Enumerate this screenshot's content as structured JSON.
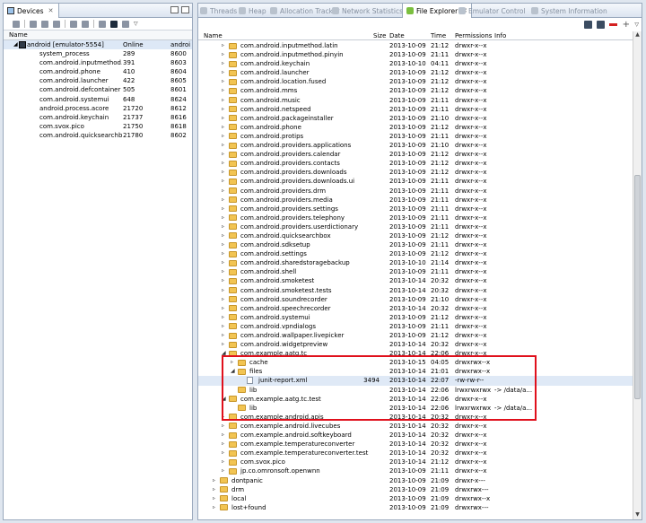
{
  "devices_view": {
    "tab_label": "Devices",
    "tab_close": "✕",
    "columns": {
      "name": "Name"
    },
    "device": {
      "name": "android [emulator-5554]",
      "status": "Online",
      "col3": "androi"
    },
    "processes": [
      {
        "name": "system_process",
        "pid": "289",
        "port": "8600"
      },
      {
        "name": "com.android.inputmethod.lati",
        "pid": "391",
        "port": "8603"
      },
      {
        "name": "com.android.phone",
        "pid": "410",
        "port": "8604"
      },
      {
        "name": "com.android.launcher",
        "pid": "422",
        "port": "8605"
      },
      {
        "name": "com.android.defcontainer",
        "pid": "505",
        "port": "8601"
      },
      {
        "name": "com.android.systemui",
        "pid": "648",
        "port": "8624"
      },
      {
        "name": "android.process.acore",
        "pid": "21720",
        "port": "8612"
      },
      {
        "name": "com.android.keychain",
        "pid": "21737",
        "port": "8616"
      },
      {
        "name": "com.svox.pico",
        "pid": "21750",
        "port": "8618"
      },
      {
        "name": "com.android.quicksearchbox",
        "pid": "21780",
        "port": "8602"
      }
    ]
  },
  "main_tabs": [
    {
      "label": "Threads",
      "icon": "threads-icon"
    },
    {
      "label": "Heap",
      "icon": "heap-icon"
    },
    {
      "label": "Allocation Tracker",
      "icon": "allocation-icon"
    },
    {
      "label": "Network Statistics",
      "icon": "network-icon"
    },
    {
      "label": "File Explorer",
      "icon": "file-explorer-icon",
      "active": true
    },
    {
      "label": "Emulator Control",
      "icon": "emulator-icon"
    },
    {
      "label": "System Information",
      "icon": "system-info-icon"
    }
  ],
  "file_explorer": {
    "columns": {
      "name": "Name",
      "size": "Size",
      "date": "Date",
      "time": "Time",
      "permissions": "Permissions",
      "info": "Info"
    },
    "rows": [
      {
        "indent": 2,
        "tw": "▹",
        "kind": "folder",
        "name": "com.android.inputmethod.latin",
        "date": "2013-10-09",
        "time": "21:12",
        "perm": "drwxr-x--x"
      },
      {
        "indent": 2,
        "tw": "▹",
        "kind": "folder",
        "name": "com.android.inputmethod.pinyin",
        "date": "2013-10-09",
        "time": "21:11",
        "perm": "drwxr-x--x"
      },
      {
        "indent": 2,
        "tw": "▹",
        "kind": "folder",
        "name": "com.android.keychain",
        "date": "2013-10-10",
        "time": "04:11",
        "perm": "drwxr-x--x"
      },
      {
        "indent": 2,
        "tw": "▹",
        "kind": "folder",
        "name": "com.android.launcher",
        "date": "2013-10-09",
        "time": "21:12",
        "perm": "drwxr-x--x"
      },
      {
        "indent": 2,
        "tw": "▹",
        "kind": "folder",
        "name": "com.android.location.fused",
        "date": "2013-10-09",
        "time": "21:12",
        "perm": "drwxr-x--x"
      },
      {
        "indent": 2,
        "tw": "▹",
        "kind": "folder",
        "name": "com.android.mms",
        "date": "2013-10-09",
        "time": "21:12",
        "perm": "drwxr-x--x"
      },
      {
        "indent": 2,
        "tw": "▹",
        "kind": "folder",
        "name": "com.android.music",
        "date": "2013-10-09",
        "time": "21:11",
        "perm": "drwxr-x--x"
      },
      {
        "indent": 2,
        "tw": "▹",
        "kind": "folder",
        "name": "com.android.netspeed",
        "date": "2013-10-09",
        "time": "21:11",
        "perm": "drwxr-x--x"
      },
      {
        "indent": 2,
        "tw": "▹",
        "kind": "folder",
        "name": "com.android.packageinstaller",
        "date": "2013-10-09",
        "time": "21:10",
        "perm": "drwxr-x--x"
      },
      {
        "indent": 2,
        "tw": "▹",
        "kind": "folder",
        "name": "com.android.phone",
        "date": "2013-10-09",
        "time": "21:12",
        "perm": "drwxr-x--x"
      },
      {
        "indent": 2,
        "tw": "▹",
        "kind": "folder",
        "name": "com.android.protips",
        "date": "2013-10-09",
        "time": "21:11",
        "perm": "drwxr-x--x"
      },
      {
        "indent": 2,
        "tw": "▹",
        "kind": "folder",
        "name": "com.android.providers.applications",
        "date": "2013-10-09",
        "time": "21:10",
        "perm": "drwxr-x--x"
      },
      {
        "indent": 2,
        "tw": "▹",
        "kind": "folder",
        "name": "com.android.providers.calendar",
        "date": "2013-10-09",
        "time": "21:12",
        "perm": "drwxr-x--x"
      },
      {
        "indent": 2,
        "tw": "▹",
        "kind": "folder",
        "name": "com.android.providers.contacts",
        "date": "2013-10-09",
        "time": "21:12",
        "perm": "drwxr-x--x"
      },
      {
        "indent": 2,
        "tw": "▹",
        "kind": "folder",
        "name": "com.android.providers.downloads",
        "date": "2013-10-09",
        "time": "21:12",
        "perm": "drwxr-x--x"
      },
      {
        "indent": 2,
        "tw": "▹",
        "kind": "folder",
        "name": "com.android.providers.downloads.ui",
        "date": "2013-10-09",
        "time": "21:11",
        "perm": "drwxr-x--x"
      },
      {
        "indent": 2,
        "tw": "▹",
        "kind": "folder",
        "name": "com.android.providers.drm",
        "date": "2013-10-09",
        "time": "21:11",
        "perm": "drwxr-x--x"
      },
      {
        "indent": 2,
        "tw": "▹",
        "kind": "folder",
        "name": "com.android.providers.media",
        "date": "2013-10-09",
        "time": "21:11",
        "perm": "drwxr-x--x"
      },
      {
        "indent": 2,
        "tw": "▹",
        "kind": "folder",
        "name": "com.android.providers.settings",
        "date": "2013-10-09",
        "time": "21:11",
        "perm": "drwxr-x--x"
      },
      {
        "indent": 2,
        "tw": "▹",
        "kind": "folder",
        "name": "com.android.providers.telephony",
        "date": "2013-10-09",
        "time": "21:11",
        "perm": "drwxr-x--x"
      },
      {
        "indent": 2,
        "tw": "▹",
        "kind": "folder",
        "name": "com.android.providers.userdictionary",
        "date": "2013-10-09",
        "time": "21:11",
        "perm": "drwxr-x--x"
      },
      {
        "indent": 2,
        "tw": "▹",
        "kind": "folder",
        "name": "com.android.quicksearchbox",
        "date": "2013-10-09",
        "time": "21:12",
        "perm": "drwxr-x--x"
      },
      {
        "indent": 2,
        "tw": "▹",
        "kind": "folder",
        "name": "com.android.sdksetup",
        "date": "2013-10-09",
        "time": "21:11",
        "perm": "drwxr-x--x"
      },
      {
        "indent": 2,
        "tw": "▹",
        "kind": "folder",
        "name": "com.android.settings",
        "date": "2013-10-09",
        "time": "21:12",
        "perm": "drwxr-x--x"
      },
      {
        "indent": 2,
        "tw": "▹",
        "kind": "folder",
        "name": "com.android.sharedstoragebackup",
        "date": "2013-10-10",
        "time": "21:14",
        "perm": "drwxr-x--x"
      },
      {
        "indent": 2,
        "tw": "▹",
        "kind": "folder",
        "name": "com.android.shell",
        "date": "2013-10-09",
        "time": "21:11",
        "perm": "drwxr-x--x"
      },
      {
        "indent": 2,
        "tw": "▹",
        "kind": "folder",
        "name": "com.android.smoketest",
        "date": "2013-10-14",
        "time": "20:32",
        "perm": "drwxr-x--x"
      },
      {
        "indent": 2,
        "tw": "▹",
        "kind": "folder",
        "name": "com.android.smoketest.tests",
        "date": "2013-10-14",
        "time": "20:32",
        "perm": "drwxr-x--x"
      },
      {
        "indent": 2,
        "tw": "▹",
        "kind": "folder",
        "name": "com.android.soundrecorder",
        "date": "2013-10-09",
        "time": "21:10",
        "perm": "drwxr-x--x"
      },
      {
        "indent": 2,
        "tw": "▹",
        "kind": "folder",
        "name": "com.android.speechrecorder",
        "date": "2013-10-14",
        "time": "20:32",
        "perm": "drwxr-x--x"
      },
      {
        "indent": 2,
        "tw": "▹",
        "kind": "folder",
        "name": "com.android.systemui",
        "date": "2013-10-09",
        "time": "21:12",
        "perm": "drwxr-x--x"
      },
      {
        "indent": 2,
        "tw": "▹",
        "kind": "folder",
        "name": "com.android.vpndialogs",
        "date": "2013-10-09",
        "time": "21:11",
        "perm": "drwxr-x--x"
      },
      {
        "indent": 2,
        "tw": "▹",
        "kind": "folder",
        "name": "com.android.wallpaper.livepicker",
        "date": "2013-10-09",
        "time": "21:12",
        "perm": "drwxr-x--x"
      },
      {
        "indent": 2,
        "tw": "▹",
        "kind": "folder",
        "name": "com.android.widgetpreview",
        "date": "2013-10-14",
        "time": "20:32",
        "perm": "drwxr-x--x"
      },
      {
        "indent": 2,
        "tw": "◢",
        "kind": "folder",
        "name": "com.example.aatg.tc",
        "date": "2013-10-14",
        "time": "22:06",
        "perm": "drwxr-x--x"
      },
      {
        "indent": 3,
        "tw": "▹",
        "kind": "folder",
        "name": "cache",
        "date": "2013-10-15",
        "time": "04:05",
        "perm": "drwxrwx--x"
      },
      {
        "indent": 3,
        "tw": "◢",
        "kind": "folder",
        "name": "files",
        "date": "2013-10-14",
        "time": "21:01",
        "perm": "drwxrwx--x"
      },
      {
        "indent": 4,
        "tw": "",
        "kind": "file",
        "name": "junit-report.xml",
        "size": "3494",
        "date": "2013-10-14",
        "time": "22:07",
        "perm": "-rw-rw-r--",
        "selected": true
      },
      {
        "indent": 3,
        "tw": "",
        "kind": "folder",
        "name": "lib",
        "date": "2013-10-14",
        "time": "22:06",
        "perm": "lrwxrwxrwx",
        "info": "-> /data/a..."
      },
      {
        "indent": 2,
        "tw": "◢",
        "kind": "folder",
        "name": "com.example.aatg.tc.test",
        "date": "2013-10-14",
        "time": "22:06",
        "perm": "drwxr-x--x"
      },
      {
        "indent": 3,
        "tw": "",
        "kind": "folder",
        "name": "lib",
        "date": "2013-10-14",
        "time": "22:06",
        "perm": "lrwxrwxrwx",
        "info": "-> /data/a..."
      },
      {
        "indent": 2,
        "tw": "▹",
        "kind": "folder",
        "name": "com.example.android.apis",
        "date": "2013-10-14",
        "time": "20:32",
        "perm": "drwxr-x--x"
      },
      {
        "indent": 2,
        "tw": "▹",
        "kind": "folder",
        "name": "com.example.android.livecubes",
        "date": "2013-10-14",
        "time": "20:32",
        "perm": "drwxr-x--x"
      },
      {
        "indent": 2,
        "tw": "▹",
        "kind": "folder",
        "name": "com.example.android.softkeyboard",
        "date": "2013-10-14",
        "time": "20:32",
        "perm": "drwxr-x--x"
      },
      {
        "indent": 2,
        "tw": "▹",
        "kind": "folder",
        "name": "com.example.temperatureconverter",
        "date": "2013-10-14",
        "time": "20:32",
        "perm": "drwxr-x--x"
      },
      {
        "indent": 2,
        "tw": "▹",
        "kind": "folder",
        "name": "com.example.temperatureconverter.test",
        "date": "2013-10-14",
        "time": "20:32",
        "perm": "drwxr-x--x"
      },
      {
        "indent": 2,
        "tw": "▹",
        "kind": "folder",
        "name": "com.svox.pico",
        "date": "2013-10-14",
        "time": "21:12",
        "perm": "drwxr-x--x"
      },
      {
        "indent": 2,
        "tw": "▹",
        "kind": "folder",
        "name": "jp.co.omronsoft.openwnn",
        "date": "2013-10-09",
        "time": "21:11",
        "perm": "drwxr-x--x"
      },
      {
        "indent": 1,
        "tw": "▹",
        "kind": "folder",
        "name": "dontpanic",
        "date": "2013-10-09",
        "time": "21:09",
        "perm": "drwxr-x---"
      },
      {
        "indent": 1,
        "tw": "▹",
        "kind": "folder",
        "name": "drm",
        "date": "2013-10-09",
        "time": "21:09",
        "perm": "drwxrwx---"
      },
      {
        "indent": 1,
        "tw": "▹",
        "kind": "folder",
        "name": "local",
        "date": "2013-10-09",
        "time": "21:09",
        "perm": "drwxrwx--x"
      },
      {
        "indent": 1,
        "tw": "▹",
        "kind": "folder",
        "name": "lost+found",
        "date": "2013-10-09",
        "time": "21:09",
        "perm": "drwxrwx---"
      }
    ]
  },
  "colors": {
    "highlight_box": "#e0101c",
    "folder": "#f2c452",
    "selection": "#dfe9f6"
  }
}
